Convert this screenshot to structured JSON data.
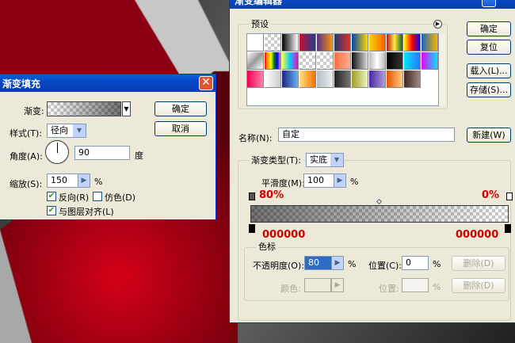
{
  "fill_dialog": {
    "title": "渐变填充",
    "close": "✕",
    "gradient_label": "渐变:",
    "style_label": "样式(T):",
    "style_value": "径向",
    "angle_label": "角度(A):",
    "angle_value": "90",
    "angle_unit": "度",
    "scale_label": "缩放(S):",
    "scale_value": "150",
    "scale_unit": "%",
    "reverse_label": "反向(R)",
    "dither_label": "仿色(D)",
    "align_label": "与图层对齐(L)",
    "ok_label": "确定",
    "cancel_label": "取消"
  },
  "editor": {
    "title": "渐变编辑器",
    "presets_label": "预设",
    "ok_label": "确定",
    "reset_label": "复位",
    "load_label": "载入(L)...",
    "save_label": "存储(S)...",
    "name_label": "名称(N):",
    "name_value": "自定",
    "new_label": "新建(W)",
    "type_label": "渐变类型(T):",
    "type_value": "实底",
    "smooth_label": "平滑度(M):",
    "smooth_value": "100",
    "smooth_unit": "%",
    "opacity_left": "80%",
    "opacity_right": "0%",
    "color_left": "000000",
    "color_right": "000000",
    "stops_group": "色标",
    "opacity_field_label": "不透明度(O):",
    "opacity_field_value": "80",
    "opacity_unit": "%",
    "location_label": "位置(C):",
    "location_value": "0",
    "location_unit": "%",
    "delete_label": "删除(D)",
    "color_field_label": "颜色:",
    "location2_label": "位置:",
    "location2_unit": "%",
    "delete2_label": "删除(D)"
  },
  "colors": {
    "accent_red": "#d10000",
    "window_bg": "#ece9d8",
    "title_blue": "#0746c2"
  }
}
